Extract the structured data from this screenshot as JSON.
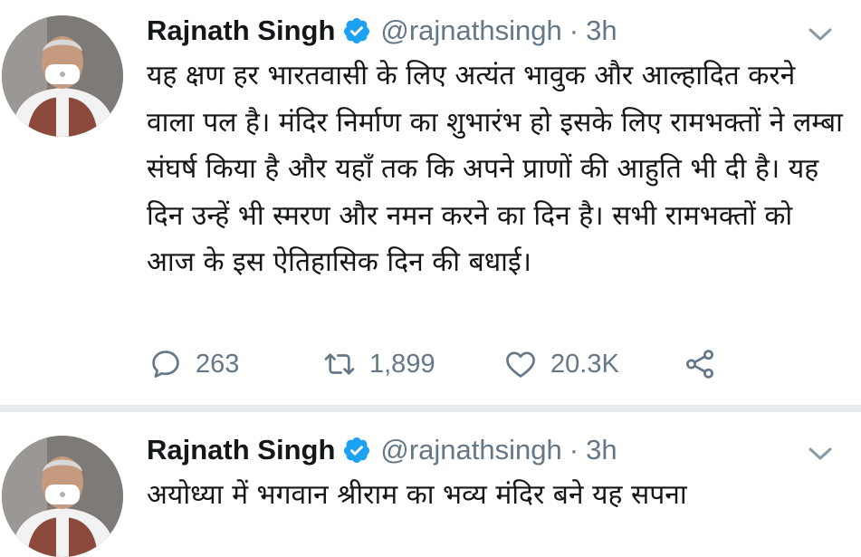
{
  "tweets": [
    {
      "author": {
        "name": "Rajnath Singh",
        "handle": "@rajnathsingh",
        "verified": true
      },
      "separator": "·",
      "time": "3h",
      "text": "यह क्षण हर भारतवासी के लिए अत्यंत भावुक और आल्हादित करने वाला पल है। मंदिर निर्माण का शुभारंभ हो इसके लिए रामभक्तों ने लम्बा संघर्ष किया है और यहाँ तक कि अपने प्राणों की आहुति भी दी है। यह दिन उन्हें भी स्मरण और नमन करने का दिन है। सभी रामभक्तों को आज के इस ऐतिहासिक दिन की बधाई।",
      "replies": "263",
      "retweets": "1,899",
      "likes": "20.3K"
    },
    {
      "author": {
        "name": "Rajnath Singh",
        "handle": "@rajnathsingh",
        "verified": true
      },
      "separator": "·",
      "time": "3h",
      "text": "अयोध्या में भगवान श्रीराम का भव्य मंदिर बने यह सपना"
    }
  ],
  "colors": {
    "text": "#14171a",
    "secondary": "#657786",
    "verified": "#1da1f2",
    "divider": "#e6ecf0"
  },
  "icons": {
    "verified": "verified-badge-icon",
    "caret": "chevron-down-icon",
    "reply": "reply-icon",
    "retweet": "retweet-icon",
    "like": "heart-icon",
    "share": "share-icon"
  }
}
